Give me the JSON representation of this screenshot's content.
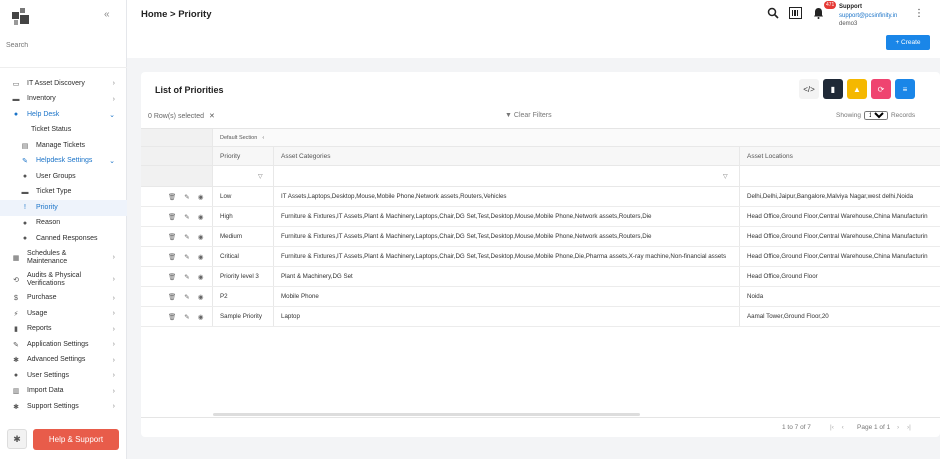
{
  "sidebar": {
    "search_placeholder": "Search",
    "items": [
      {
        "label": "IT Asset Discovery",
        "icon": "laptop-icon"
      },
      {
        "label": "Inventory",
        "icon": "monitor-icon"
      },
      {
        "label": "Help Desk",
        "icon": "help-circle-icon"
      },
      {
        "label": "Ticket Status"
      },
      {
        "label": "Manage Tickets",
        "icon": "tickets-icon"
      },
      {
        "label": "Helpdesk Settings",
        "icon": "wrench-icon"
      },
      {
        "label": "User Groups",
        "icon": "users-icon"
      },
      {
        "label": "Ticket Type",
        "icon": "keyboard-icon"
      },
      {
        "label": "Priority",
        "icon": "priority-icon"
      },
      {
        "label": "Reason",
        "icon": "chat-icon"
      },
      {
        "label": "Canned Responses",
        "icon": "chats-icon"
      },
      {
        "label": "Schedules & Maintenance",
        "icon": "calendar-icon"
      },
      {
        "label": "Audits & Physical Verifications",
        "icon": "audit-icon"
      },
      {
        "label": "Purchase",
        "icon": "dollar-icon"
      },
      {
        "label": "Usage",
        "icon": "plug-icon"
      },
      {
        "label": "Reports",
        "icon": "file-icon"
      },
      {
        "label": "Application Settings",
        "icon": "wrench-icon"
      },
      {
        "label": "Advanced Settings",
        "icon": "gears-icon"
      },
      {
        "label": "User Settings",
        "icon": "user-gear-icon"
      },
      {
        "label": "Import Data",
        "icon": "database-icon"
      },
      {
        "label": "Support Settings",
        "icon": "support-gear-icon"
      }
    ],
    "help_button": "Help & Support"
  },
  "header": {
    "breadcrumb": "Home > Priority",
    "notification_count": "471",
    "user_name": "Support",
    "user_email": "support@pcsinfinity.in",
    "user_account": "demo3",
    "create_label": "+ Create"
  },
  "card": {
    "title": "List of Priorities",
    "rows_selected": "0 Row(s) selected",
    "clear_filters": "Clear Filters",
    "showing_label": "Showing",
    "page_size": "100",
    "records_label": "Records",
    "group_header": "Default Section",
    "columns": [
      "Priority",
      "Asset Categories",
      "Asset Locations"
    ],
    "colors": {
      "code": "#f3f3f3",
      "doc": "#1f2937",
      "warn": "#f5b800",
      "refresh": "#ef4470",
      "list": "#1a86e8"
    }
  },
  "rows": [
    {
      "priority": "Low",
      "categories": "IT Assets,Laptops,Desktop,Mouse,Mobile Phone,Network assets,Routers,Vehicles",
      "locations": "Delhi,Delhi,Jaipur,Bangalore,Malviya Nagar,west delhi,Noida"
    },
    {
      "priority": "High",
      "categories": "Furniture & Fixtures,IT Assets,Plant & Machinery,Laptops,Chair,DG Set,Test,Desktop,Mouse,Mobile Phone,Network assets,Routers,Die",
      "locations": "Head Office,Ground Floor,Central Warehouse,China Manufacturin"
    },
    {
      "priority": "Medium",
      "categories": "Furniture & Fixtures,IT Assets,Plant & Machinery,Laptops,Chair,DG Set,Test,Desktop,Mouse,Mobile Phone,Network assets,Routers,Die",
      "locations": "Head Office,Ground Floor,Central Warehouse,China Manufacturin"
    },
    {
      "priority": "Critical",
      "categories": "Furniture & Fixtures,IT Assets,Plant & Machinery,Laptops,Chair,DG Set,Test,Desktop,Mouse,Mobile Phone,Die,Pharma assets,X-ray machine,Non-financial assets",
      "locations": "Head Office,Ground Floor,Central Warehouse,China Manufacturin"
    },
    {
      "priority": "Priority level 3",
      "categories": "Plant & Machinery,DG Set",
      "locations": "Head Office,Ground Floor"
    },
    {
      "priority": "P2",
      "categories": "Mobile Phone",
      "locations": "Noida"
    },
    {
      "priority": "Sample Priority",
      "categories": "Laptop",
      "locations": "Aamal Tower,Ground Floor,20"
    }
  ],
  "footer": {
    "range": "1 to 7 of 7",
    "page": "Page 1 of 1"
  }
}
